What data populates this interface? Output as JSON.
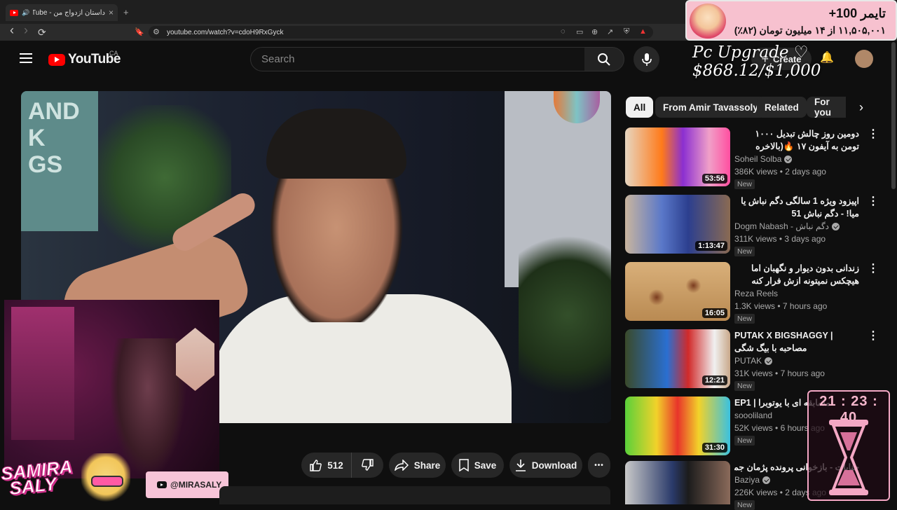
{
  "browser": {
    "tab_title": "داستان ازدواج من - YouTube",
    "new_tab": "+",
    "close_tab": "×",
    "back": "‹",
    "forward": "›",
    "reload": "⟳",
    "url": "youtube.com/watch?v=cdoH9RxGyck"
  },
  "header": {
    "logo_text": "YouTube",
    "country": "CA",
    "search_placeholder": "Search",
    "create_label": "Create"
  },
  "actions": {
    "like_count": "512",
    "share": "Share",
    "save": "Save",
    "download": "Download",
    "more": "•••"
  },
  "chips": [
    "All",
    "From Amir Tavassoly",
    "Related",
    "For you"
  ],
  "recommendations": [
    {
      "title": "دومین روز چالش تبدیل ۱۰۰۰ تومن به آیفون ۱۷ 🔥(بالاخره خریدیمش)",
      "channel": "Soheil Solba",
      "views": "386K views",
      "age": "2 days ago",
      "duration": "53:56",
      "badge": "New"
    },
    {
      "title": "اپیزود ویژه 1 سالگی دگم نباش یا میا! - دگم نباش 51",
      "channel": "Dogm Nabash - دگم نباش",
      "views": "311K views",
      "age": "3 days ago",
      "duration": "1:13:47",
      "badge": "New"
    },
    {
      "title": "زندانی بدون دیوار و نگهبان اما هیچکس نمیتونه ازش فرار کنه",
      "channel": "Reza Reels",
      "views": "1.3K views",
      "age": "7 hours ago",
      "duration": "16:05",
      "badge": "New"
    },
    {
      "title": "PUTAK X BIGSHAGGY | مصاحبه با بیگ شگی",
      "channel": "PUTAK",
      "views": "31K views",
      "age": "7 hours ago",
      "duration": "12:21",
      "badge": "New"
    },
    {
      "title": "EP1 | مسابقه ای با یوتوبرا",
      "channel": "soooliland",
      "views": "52K views",
      "age": "6 hours ago",
      "duration": "31:30",
      "badge": "New"
    },
    {
      "title": "جنایات - بازخوانی پرونده پژمان جمشیدی",
      "channel": "Baziya",
      "views": "226K views",
      "age": "2 days ago",
      "duration": "",
      "badge": "New"
    }
  ],
  "overlays": {
    "donation_title": "تایمر 100+",
    "donation_sub": "۱۱,۵۰۵,۰۰۱ از ۱۴ میلیون تومان (۸۲٪)",
    "goal": "Pc Upgrade ♡ $868.12/$1,000",
    "timer": "21 : 23 : 40",
    "streamer_name_1": "SAMIRA",
    "streamer_name_2": "SALY",
    "social_handle": "@MIRASALY"
  },
  "video_poster_text": "AND\nK\nGS",
  "colors": {
    "accent": "#ff0000",
    "background": "#0f0f0f",
    "overlay_pink": "#f7c1cf"
  }
}
